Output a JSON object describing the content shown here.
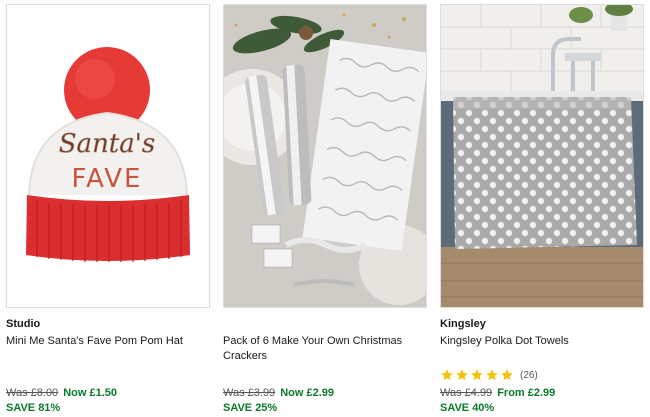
{
  "products": [
    {
      "brand": "Studio",
      "title": "Mini Me Santa's Fave Pom Pom Hat",
      "image_text_line1": "Santa's",
      "image_text_line2": "FAVE",
      "was": "Was £8.00",
      "now": "Now £1.50",
      "save": "SAVE 81%"
    },
    {
      "brand": "",
      "title": "Pack of 6 Make Your Own Christmas Crackers",
      "was": "Was £3.99",
      "now": "Now £2.99",
      "save": "SAVE 25%"
    },
    {
      "brand": "Kingsley",
      "title": "Kingsley Polka Dot Towels",
      "rating": {
        "stars": 5,
        "count": "(26)"
      },
      "was": "Was £4.99",
      "now": "From £2.99",
      "save": "SAVE 40%"
    }
  ],
  "colors": {
    "sale_green": "#0a7a2a",
    "star_yellow": "#f4c20d",
    "card_border": "#dddddd"
  }
}
